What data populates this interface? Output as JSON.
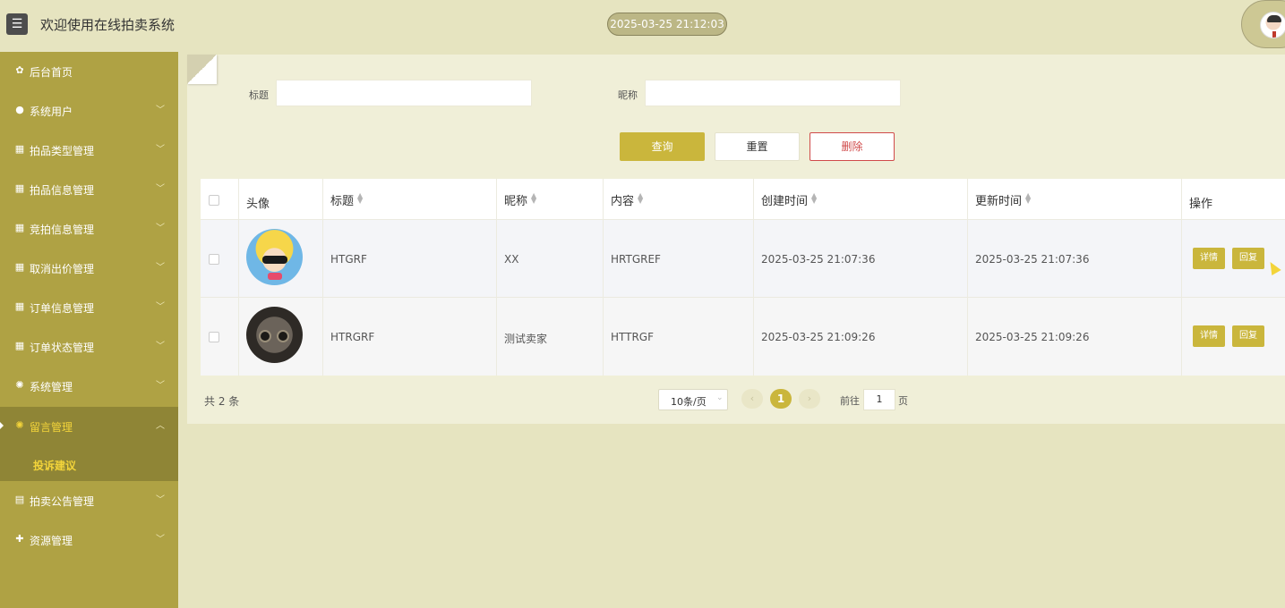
{
  "header": {
    "title": "欢迎使用在线拍卖系统",
    "datetime": "2025-03-25 21:12:03",
    "menu_icon": "menu-icon",
    "avatar": "user-avatar"
  },
  "sidebar": {
    "items": [
      {
        "label": "后台首页",
        "icon": "home-icon",
        "glyph": "✿",
        "expandable": false
      },
      {
        "label": "系统用户",
        "icon": "user-icon",
        "glyph": "●",
        "expandable": true
      },
      {
        "label": "拍品类型管理",
        "icon": "grid-icon",
        "glyph": "▦",
        "expandable": true
      },
      {
        "label": "拍品信息管理",
        "icon": "grid-icon",
        "glyph": "▦",
        "expandable": true
      },
      {
        "label": "竞拍信息管理",
        "icon": "grid-icon",
        "glyph": "▦",
        "expandable": true
      },
      {
        "label": "取消出价管理",
        "icon": "grid-icon",
        "glyph": "▦",
        "expandable": true
      },
      {
        "label": "订单信息管理",
        "icon": "grid-icon",
        "glyph": "▦",
        "expandable": true
      },
      {
        "label": "订单状态管理",
        "icon": "grid-icon",
        "glyph": "▦",
        "expandable": true
      },
      {
        "label": "系统管理",
        "icon": "gear-icon",
        "glyph": "✺",
        "expandable": true
      },
      {
        "label": "留言管理",
        "icon": "gear-icon",
        "glyph": "✺",
        "expandable": true,
        "active": true
      },
      {
        "label": "拍卖公告管理",
        "icon": "document-icon",
        "glyph": "▤",
        "expandable": true
      },
      {
        "label": "资源管理",
        "icon": "plus-circle-icon",
        "glyph": "✚",
        "expandable": true
      }
    ],
    "sub_item": "投诉建议"
  },
  "search": {
    "title_label": "标题",
    "title_value": "",
    "nickname_label": "昵称",
    "nickname_value": ""
  },
  "buttons": {
    "query": "查询",
    "reset": "重置",
    "delete": "删除"
  },
  "table": {
    "columns": [
      "头像",
      "标题",
      "昵称",
      "内容",
      "创建时间",
      "更新时间",
      "操作"
    ],
    "rows": [
      {
        "avatar": "cartoon-avatar",
        "title": "HTGRF",
        "nickname": "XX",
        "content": "HRTGREF",
        "created": "2025-03-25 21:07:36",
        "updated": "2025-03-25 21:07:36"
      },
      {
        "avatar": "plush-avatar",
        "title": "HTRGRF",
        "nickname": "测试卖家",
        "content": "HTTRGF",
        "created": "2025-03-25 21:09:26",
        "updated": "2025-03-25 21:09:26"
      }
    ],
    "action_detail": "详情",
    "action_reply": "回复"
  },
  "pagination": {
    "total": "共 2 条",
    "page_size": "10条/页",
    "prev": "‹",
    "current": "1",
    "next": "›",
    "goto_label": "前往",
    "goto_value": "1",
    "page_suffix": "页"
  },
  "colors": {
    "accent": "#cab63c",
    "sidebar": "#afa244",
    "sidebar_active": "#8f8536",
    "danger": "#d04a4a"
  }
}
